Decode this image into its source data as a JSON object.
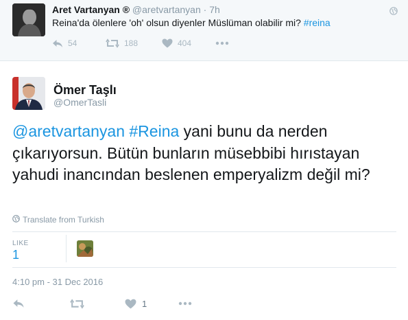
{
  "parent_tweet": {
    "name": "Aret Vartanyan ®",
    "handle": "@aretvartanyan",
    "separator": "·",
    "time": "7h",
    "text_main": "Reina'da ölenlere 'oh' olsun diyenler Müslüman olabilir mi? ",
    "hashtag": "#reina",
    "replies": "54",
    "retweets": "188",
    "likes": "404",
    "icons": [
      "reply-icon",
      "retweet-icon",
      "heart-icon",
      "more-icon",
      "globe-icon"
    ]
  },
  "main_tweet": {
    "name": "Ömer Taşlı",
    "handle": "@OmerTasli",
    "mention": "@aretvartanyan",
    "hashtag": "#Reina",
    "text_rest": " yani bunu da nerden çıkarıyorsun. Bütün bunların müsebbibi hırıstayan yahudi inancından beslenen emperyalizm değil mi?",
    "translate": "Translate from Turkish",
    "likes_label": "LIKE",
    "likes_count": "1",
    "timestamp": "4:10 pm - 31 Dec 2016",
    "action_like_count": "1",
    "icons": [
      "reply-icon",
      "retweet-icon",
      "heart-icon",
      "more-icon",
      "globe-icon"
    ]
  },
  "colors": {
    "link": "#1b95e0",
    "muted": "#8899a6",
    "parent_bg": "#f5f8fa",
    "border": "#e1e8ed"
  }
}
